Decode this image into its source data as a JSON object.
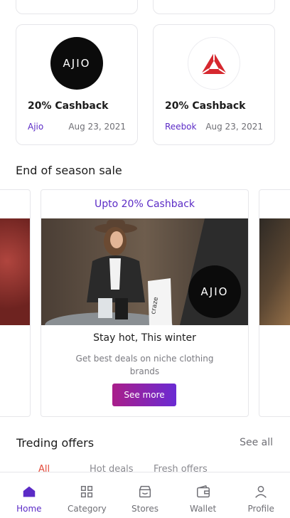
{
  "brands": [
    {
      "logo_text": "AJIO",
      "cashback": "20% Cashback",
      "name": "Ajio",
      "date": "Aug 23, 2021"
    },
    {
      "logo_text": "",
      "cashback": "20% Cashback",
      "name": "Reebok",
      "date": "Aug 23, 2021"
    }
  ],
  "season_sale": {
    "title": "End of season sale",
    "card": {
      "tag": "Upto 20% Cashback",
      "logo_text": "AJIO",
      "bag_text": "craze",
      "headline": "Stay hot, This winter",
      "description": "Get best deals on niche clothing brands",
      "button": "See more"
    }
  },
  "offers": {
    "title": "Treding offers",
    "see_all": "See all",
    "filters": [
      "All",
      "Hot deals",
      "Fresh offers"
    ],
    "active_filter": "All"
  },
  "bottom_nav": [
    {
      "label": "Home",
      "icon": "home-icon",
      "active": true
    },
    {
      "label": "Category",
      "icon": "category-grid-icon",
      "active": false
    },
    {
      "label": "Stores",
      "icon": "store-icon",
      "active": false
    },
    {
      "label": "Wallet",
      "icon": "wallet-icon",
      "active": false
    },
    {
      "label": "Profile",
      "icon": "profile-icon",
      "active": false
    }
  ],
  "colors": {
    "accent": "#5b2bc6",
    "button_gradient_start": "#a91e8a",
    "button_gradient_end": "#6a2bd3",
    "active_filter": "#e24a3b"
  }
}
